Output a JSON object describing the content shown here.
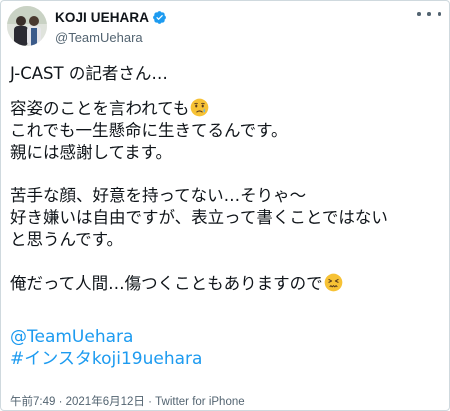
{
  "author": {
    "display_name": "KOJI UEHARA",
    "handle": "@TeamUehara",
    "verified": true,
    "avatar": "avatar-photo-icon"
  },
  "tweet": {
    "lines": [
      "J-CAST の記者さん…",
      "容姿のことを言われても",
      "これでも一生懸命に生きてるんです。",
      "親には感謝してます。",
      "苦手な顔、好意を持ってない…そりゃ～",
      "好き嫌いは自由ですが、表立って書くことではない",
      "と思うんです。",
      "俺だって人間…傷つくこともありますので"
    ],
    "emoji_1": "crying-face-emoji",
    "emoji_2": "persevering-face-emoji",
    "mention": "@TeamUehara",
    "hashtag": "#インスタkoji19uehara"
  },
  "meta": {
    "time": "午前7:49",
    "separator": " · ",
    "date": "2021年6月12日",
    "source": "Twitter for iPhone"
  },
  "colors": {
    "link": "#1d9bf0",
    "verified_badge": "#1d9bf0",
    "secondary_text": "#536471"
  }
}
